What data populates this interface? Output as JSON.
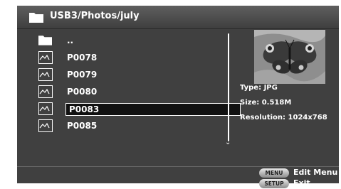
{
  "title": {
    "path": "USB3/Photos/july",
    "icon": "folder-icon"
  },
  "files": [
    {
      "name": "..",
      "icon": "folder-icon",
      "selected": false
    },
    {
      "name": "P0078",
      "icon": "image-icon",
      "selected": false
    },
    {
      "name": "P0079",
      "icon": "image-icon",
      "selected": false
    },
    {
      "name": "P0080",
      "icon": "image-icon",
      "selected": false
    },
    {
      "name": "P0083",
      "icon": "image-icon",
      "selected": true
    },
    {
      "name": "P0085",
      "icon": "image-icon",
      "selected": false
    }
  ],
  "preview": {
    "type": "Type: JPG",
    "size": "Size: 0.518M",
    "resolution": "Resolution: 1024x768"
  },
  "footer": {
    "menu_key": "MENU",
    "menu_label": "Edit Menu",
    "setup_key": "SETUP",
    "setup_label": "Exit"
  },
  "colors": {
    "background": "#404040",
    "text": "#ffffff",
    "selection": "#111111"
  }
}
